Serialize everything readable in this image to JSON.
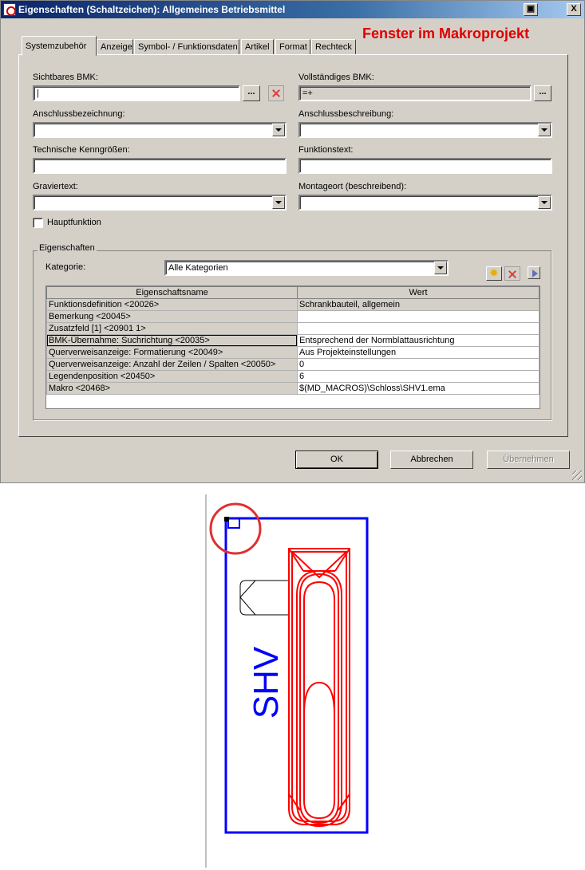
{
  "window": {
    "title": "Eigenschaften (Schaltzeichen): Allgemeines Betriebsmittel",
    "pin_glyph": "▣",
    "close_glyph": "X",
    "annotation": "Fenster im Makroprojekt"
  },
  "tabs": [
    "Systemzubehör",
    "Anzeige",
    "Symbol- / Funktionsdaten",
    "Artikel",
    "Format",
    "Rechteck"
  ],
  "form": {
    "sichtbares_bmk": {
      "label": "Sichtbares BMK:",
      "value": "|"
    },
    "vollstaendiges_bmk": {
      "label": "Vollständiges BMK:",
      "value": "=+"
    },
    "anschlussbezeichnung": {
      "label": "Anschlussbezeichnung:",
      "value": ""
    },
    "anschlussbeschreibung": {
      "label": "Anschlussbeschreibung:",
      "value": ""
    },
    "technische_kenngroessen": {
      "label": "Technische Kenngrößen:",
      "value": ""
    },
    "funktionstext": {
      "label": "Funktionstext:",
      "value": ""
    },
    "graviertext": {
      "label": "Graviertext:",
      "value": ""
    },
    "montageort": {
      "label": "Montageort (beschreibend):",
      "value": ""
    },
    "hauptfunktion": {
      "label": "Hauptfunktion",
      "checked": false
    },
    "dots_label": "..."
  },
  "properties": {
    "group_title": "Eigenschaften",
    "kategorie_label": "Kategorie:",
    "kategorie_value": "Alle Kategorien",
    "columns": [
      "Eigenschaftsname",
      "Wert"
    ],
    "rows": [
      {
        "name": "Funktionsdefinition <20026>",
        "value": "Schrankbauteil, allgemein"
      },
      {
        "name": "Bemerkung <20045>",
        "value": ""
      },
      {
        "name": "Zusatzfeld [1] <20901 1>",
        "value": ""
      },
      {
        "name": "BMK-Übernahme: Suchrichtung <20035>",
        "value": "Entsprechend der Normblattausrichtung"
      },
      {
        "name": "Querverweisanzeige: Formatierung <20049>",
        "value": "Aus Projekteinstellungen"
      },
      {
        "name": "Querverweisanzeige: Anzahl der Zeilen / Spalten <20050>",
        "value": "0"
      },
      {
        "name": "Legendenposition <20450>",
        "value": "6"
      },
      {
        "name": "Makro <20468>",
        "value": "$(MD_MACROS)\\Schloss\\SHV1.ema"
      }
    ]
  },
  "buttons": {
    "ok": "OK",
    "cancel": "Abbrechen",
    "apply": "Übernehmen"
  },
  "drawing": {
    "device_label": "SHV",
    "frame_color": "#0000ff",
    "symbol_color": "#ff0000",
    "highlight_color": "#e03030"
  }
}
